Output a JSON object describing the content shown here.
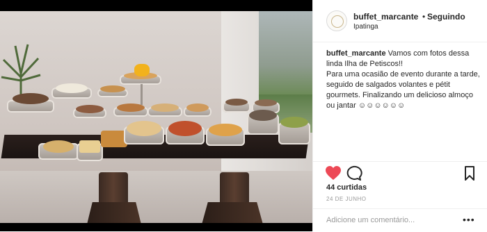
{
  "post": {
    "username": "buffet_marcante",
    "separator": "•",
    "follow_state": "Seguindo",
    "location": "Ipatinga",
    "caption_user": "buffet_marcante",
    "caption_text_1": " Vamos com fotos dessa linda Ilha de Petiscos!!",
    "caption_text_2": "Para uma ocasião de evento durante a tarde, seguido de salgados volantes e pétit gourmets. Finalizando um delicioso almoço ou jantar ☺☺☺☺☺☺",
    "likes": "44 curtidas",
    "date": "24 DE JUNHO",
    "comment_placeholder": "Adicione um comentário...",
    "more_label": "•••"
  },
  "icons": {
    "like": "heart-icon",
    "comment": "comment-icon",
    "save": "bookmark-icon",
    "like_color": "#ed4956"
  }
}
